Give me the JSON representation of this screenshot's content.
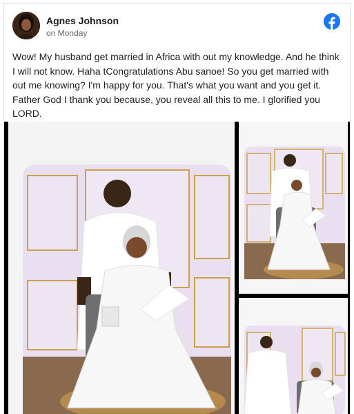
{
  "post": {
    "author_name": "Agnes Johnson",
    "timestamp": "on Monday",
    "text": "Wow! My husband get married in Africa with out my knowledge. And he think I will not know. Haha tCongratulations Abu sanoe! So you get married with out me knowing? I'm happy for you. That's what you want and you get it. Father God I thank you because, you reveal all this to me. I glorified you LORD."
  },
  "icons": {
    "platform_logo": "facebook-logo-icon"
  },
  "colors": {
    "facebook_blue": "#1877f2",
    "name_text": "#1c1e21",
    "meta_text": "#65676b",
    "gallery_background": "#000000"
  },
  "photos": [
    {
      "id": "main",
      "subject": "couple-in-white-attire-seated-bride-standing-groom"
    },
    {
      "id": "top-right",
      "subject": "couple-in-white-attire-seated-bride-standing-groom"
    },
    {
      "id": "bottom-right",
      "subject": "couple-in-white-attire-standing-groom-seated-bride"
    }
  ]
}
